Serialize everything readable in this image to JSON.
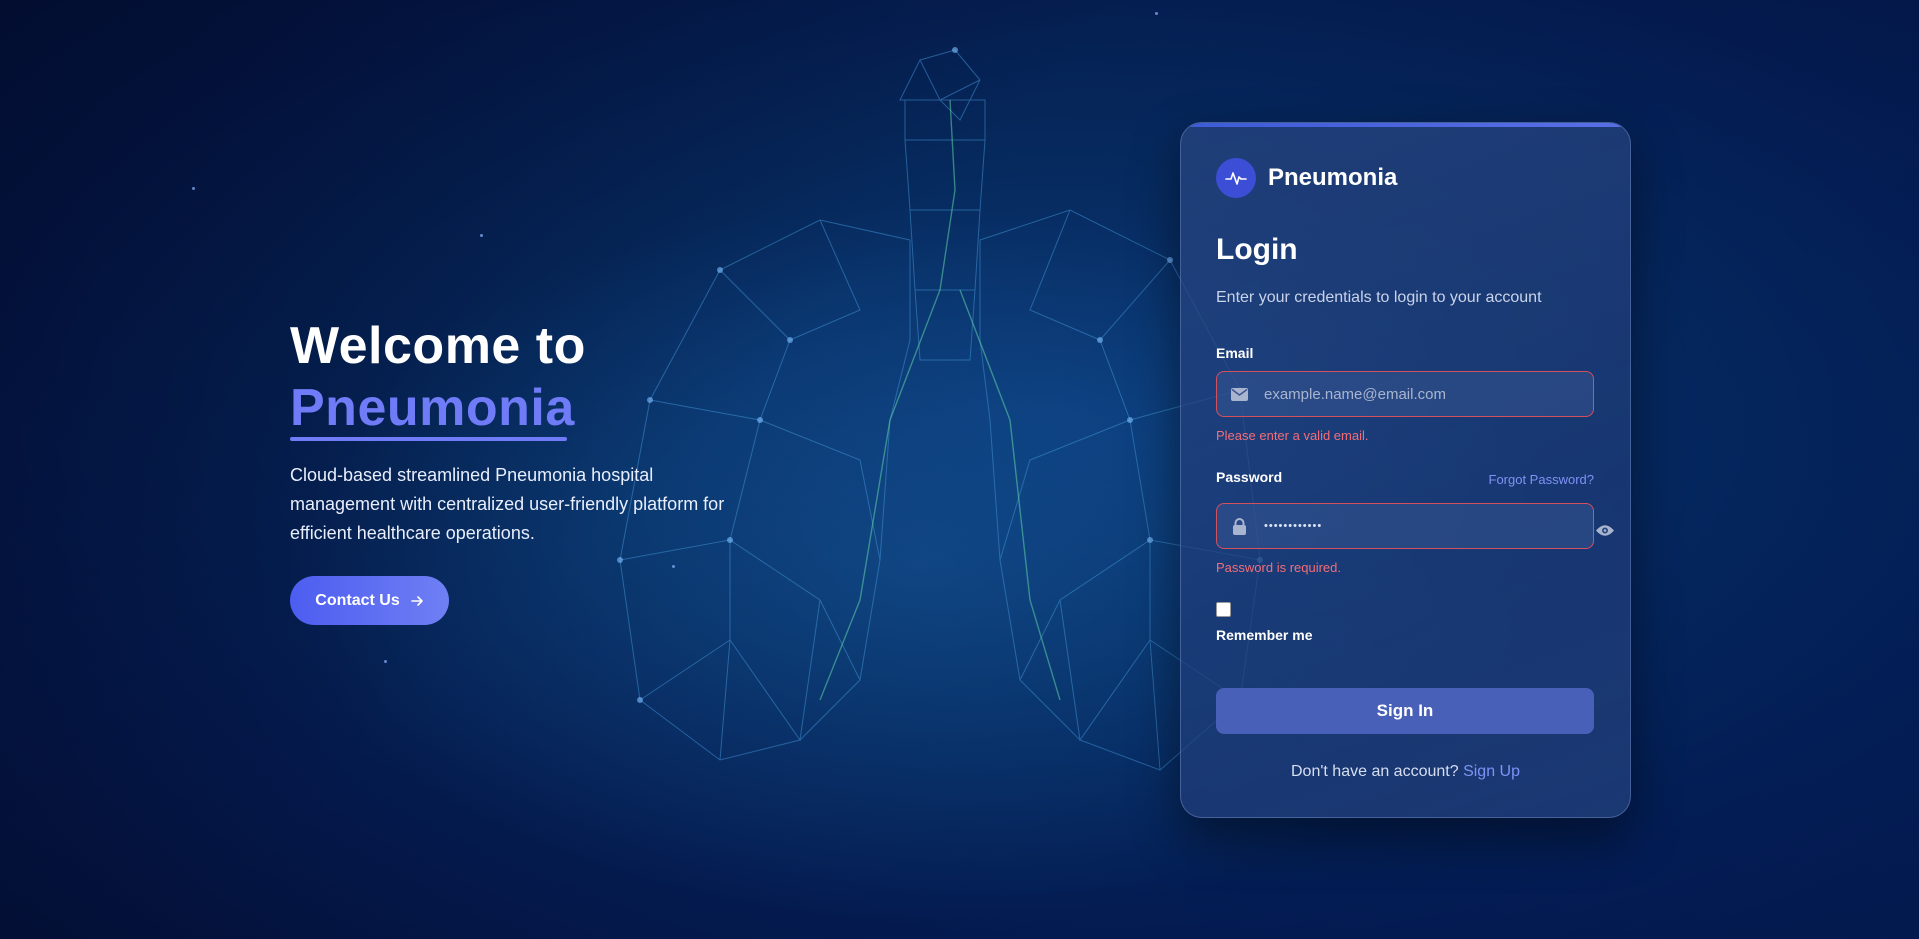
{
  "hero": {
    "title_line1": "Welcome to",
    "title_line2": "Pneumonia",
    "description": "Cloud-based streamlined Pneumonia hospital management with centralized user-friendly platform for efficient healthcare operations.",
    "contact_label": "Contact Us",
    "contact_icon": "arrow-right-icon"
  },
  "card": {
    "brand_name": "Pneumonia",
    "brand_icon": "heartbeat-icon",
    "title": "Login",
    "subtitle": "Enter your credentials to login to your account",
    "email": {
      "label": "Email",
      "placeholder": "example.name@email.com",
      "value": "",
      "error": "Please enter a valid email.",
      "icon": "envelope-icon"
    },
    "password": {
      "label": "Password",
      "forgot_label": "Forgot Password?",
      "value": "••••••••••••",
      "error": "Password is required.",
      "icon": "lock-icon",
      "toggle_icon": "eye-icon"
    },
    "remember_label": "Remember me",
    "remember_checked": false,
    "signin_label": "Sign In",
    "signup_prompt": "Don't have an account?",
    "signup_link": "Sign Up"
  },
  "colors": {
    "accent": "#6f7bf7",
    "error": "#f36d78",
    "button": "#4860b8",
    "brand_circle": "#3d4ed6"
  }
}
